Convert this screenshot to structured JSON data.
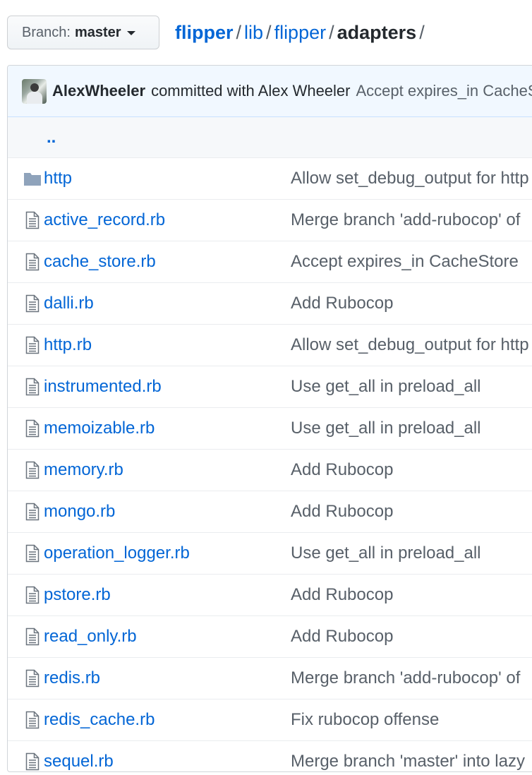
{
  "branch": {
    "prefix": "Branch:",
    "name": "master"
  },
  "breadcrumb": {
    "root": "flipper",
    "parts": [
      "lib",
      "flipper"
    ],
    "current": "adapters",
    "sep": "/"
  },
  "commit": {
    "author": "AlexWheeler",
    "with_text": "committed with Alex Wheeler",
    "message": "Accept expires_in CacheStore"
  },
  "parent_dir": "..",
  "files": [
    {
      "name": "http",
      "type": "dir",
      "icon": "folder-icon",
      "message": "Allow set_debug_output for http"
    },
    {
      "name": "active_record.rb",
      "type": "file",
      "icon": "file-icon",
      "message": "Merge branch 'add-rubocop' of"
    },
    {
      "name": "cache_store.rb",
      "type": "file",
      "icon": "file-icon",
      "message": "Accept expires_in CacheStore"
    },
    {
      "name": "dalli.rb",
      "type": "file",
      "icon": "file-icon",
      "message": "Add Rubocop"
    },
    {
      "name": "http.rb",
      "type": "file",
      "icon": "file-icon",
      "message": "Allow set_debug_output for http"
    },
    {
      "name": "instrumented.rb",
      "type": "file",
      "icon": "file-icon",
      "message": "Use get_all in preload_all"
    },
    {
      "name": "memoizable.rb",
      "type": "file",
      "icon": "file-icon",
      "message": "Use get_all in preload_all"
    },
    {
      "name": "memory.rb",
      "type": "file",
      "icon": "file-icon",
      "message": "Add Rubocop"
    },
    {
      "name": "mongo.rb",
      "type": "file",
      "icon": "file-icon",
      "message": "Add Rubocop"
    },
    {
      "name": "operation_logger.rb",
      "type": "file",
      "icon": "file-icon",
      "message": "Use get_all in preload_all"
    },
    {
      "name": "pstore.rb",
      "type": "file",
      "icon": "file-icon",
      "message": "Add Rubocop"
    },
    {
      "name": "read_only.rb",
      "type": "file",
      "icon": "file-icon",
      "message": "Add Rubocop"
    },
    {
      "name": "redis.rb",
      "type": "file",
      "icon": "file-icon",
      "message": "Merge branch 'add-rubocop' of"
    },
    {
      "name": "redis_cache.rb",
      "type": "file",
      "icon": "file-icon",
      "message": "Fix rubocop offense"
    },
    {
      "name": "sequel.rb",
      "type": "file",
      "icon": "file-icon",
      "message": "Merge branch 'master' into lazy"
    }
  ],
  "colors": {
    "link": "#0366d6",
    "muted": "#586069",
    "folder": "#79b8ff",
    "tease_bg": "#f1f8ff"
  }
}
